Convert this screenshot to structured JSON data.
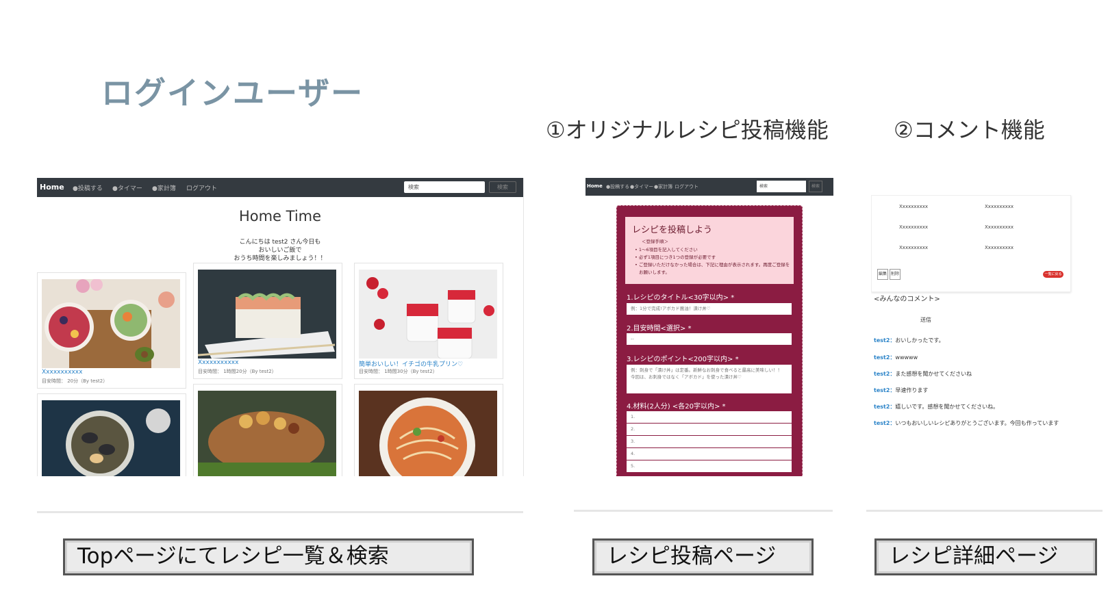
{
  "main_title": "ログインユーザー",
  "sections": {
    "post": "①オリジナルレシピ投稿機能",
    "comment": "②コメント機能"
  },
  "labels": {
    "top": "Topページにてレシピ一覧＆検索",
    "post": "レシピ投稿ページ",
    "detail": "レシピ詳細ページ"
  },
  "top_page": {
    "nav": {
      "brand": "Home",
      "items": [
        "●投稿する",
        "●タイマー",
        "●家計簿",
        "ログアウト"
      ],
      "search_placeholder": "検索",
      "search_button": "検索"
    },
    "title": "Home Time",
    "greeting": [
      "こんにちは test2 さん今日も",
      "おいしいご飯で",
      "おうち時間を楽しみましょう！！"
    ],
    "cards": [
      {
        "title": "Xxxxxxxxxxx",
        "meta": "目安時間： 20分（By test2）"
      },
      {
        "title": "Xxxxxxxxxxx",
        "meta": "目安時間： 1時間20分（By test2）"
      },
      {
        "title": "簡単おいしい！イチゴの牛乳プリン♡",
        "meta": "目安時間： 1時間30分（By test2）"
      }
    ]
  },
  "post_page": {
    "nav": {
      "brand": "Home",
      "items": [
        "●投稿する",
        "●タイマー",
        "●家計簿",
        "ログアウト"
      ],
      "search_placeholder": "検索",
      "search_button": "検索"
    },
    "heading": "レシピを投稿しよう",
    "steps_title": "＜登録手順＞",
    "steps": [
      "• 1〜6項目を記入してください",
      "• 必ず1項目につき1つの登録が必要です",
      "• ご登録いただけなかった場合は、下記に理由が表示されます。再度ご登録を",
      "お願いします。"
    ],
    "fields": [
      {
        "label": "1.レシピのタイトル<30字以内> *",
        "placeholder": "例：1分で完成!アボカド醤油！漬け丼♡"
      },
      {
        "label": "2.目安時間<選択> *",
        "placeholder": "--"
      },
      {
        "label": "3.レシピのポイント<200字以内> *",
        "placeholder": "例：刺身で「漬け丼」は定番。新鮮なお刺身で食べると最高に美味しい！！ 今回は、お刺身ではなく「アボカド」を使った漬け丼♡"
      },
      {
        "label": "4.材料(2人分) <各20字以内> *",
        "placeholder": ""
      }
    ],
    "ingredient_numbers": [
      "1.",
      "2.",
      "3.",
      "4.",
      "5."
    ]
  },
  "detail_page": {
    "grid": [
      "Xxxxxxxxxx",
      "Xxxxxxxxxx",
      "Xxxxxxxxxx",
      "Xxxxxxxxxx",
      "Xxxxxxxxxx",
      "Xxxxxxxxxx"
    ],
    "edit_button": "編集",
    "delete_button": "削除",
    "back_button": "一覧に戻る",
    "comments_title": "<みんなのコメント>",
    "send_label": "送信",
    "comments": [
      {
        "user": "test2：",
        "text": "おいしかったです。"
      },
      {
        "user": "test2：",
        "text": "wwwww"
      },
      {
        "user": "test2：",
        "text": "また感想を聞かせてくださいね"
      },
      {
        "user": "test2：",
        "text": "早速作ります"
      },
      {
        "user": "test2：",
        "text": "嬉しいです。感想を聞かせてくださいね。"
      },
      {
        "user": "test2：",
        "text": "いつもおいしいレシピありがとうございます。今回も作っています"
      }
    ]
  },
  "colors": {
    "accent_title": "#7a94a4",
    "navbar": "#343a40",
    "form_panel": "#8b1c42",
    "pink_box": "#fbd5dc",
    "link": "#2a83c8",
    "danger": "#d9322e"
  }
}
